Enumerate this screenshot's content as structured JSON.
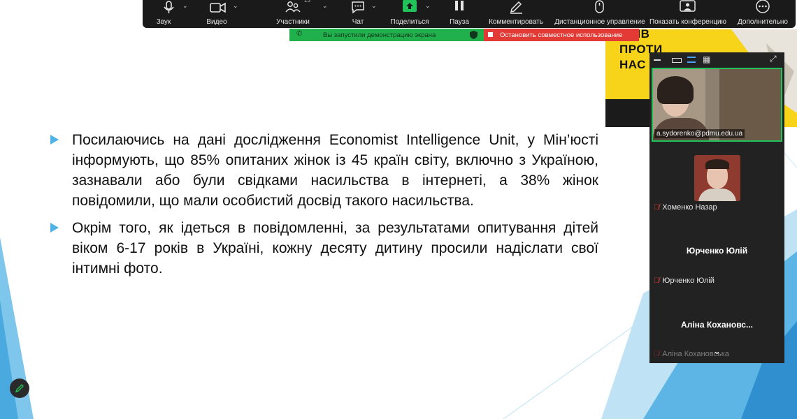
{
  "toolbar": {
    "audio_label": "Звук",
    "video_label": "Видео",
    "participants_label": "Участники",
    "participants_count": "13",
    "chat_label": "Чат",
    "share_label": "Поделиться",
    "pause_label": "Пауза",
    "annotate_label": "Комментировать",
    "remote_label": "Дистанционное управление",
    "show_conf_label": "Показать конференцию",
    "more_label": "Дополнительно"
  },
  "share_bar": {
    "status_text": "Вы запустили демонстрацию экрана",
    "stop_text": "Остановить совместное использование"
  },
  "slide": {
    "bullets": [
      "Посилаючись на дані дослідження Economist Intelligence Unit, у Мін’юсті інформують, що 85% опитаних жінок із 45 країн світу, включно з Україною, зазнавали або були свідками насильства в інтернеті, а 38% жінок повідомили, що мали особистий досвід такого насильства.",
      "Окрім того, як ідеться в повідомленні, за результатами опитування дітей віком 6-17 років в Україні, кожну десяту дитину просили надіслати свої інтимні фото."
    ],
    "poster_lines": [
      "ДНІВ",
      "ПРОТИ",
      "НАС"
    ]
  },
  "gallery": {
    "speaker_tag": "a.sydorenko@pdmu.edu.ua",
    "p2_name": "Хоменко Назар",
    "p3_display": "Юрченко Юлій",
    "p3_name": "Юрченко Юлій",
    "p4_display": "Аліна  Кохановс...",
    "p4_name": "Аліна Кохановська"
  },
  "colors": {
    "toolbar_bg": "#1a1a1a",
    "share_green": "#21b14c",
    "share_red": "#e33a36",
    "active_speaker_border": "#21c25a",
    "bullet_blue": "#4fb3e8",
    "poster_yellow": "#f7d319"
  }
}
